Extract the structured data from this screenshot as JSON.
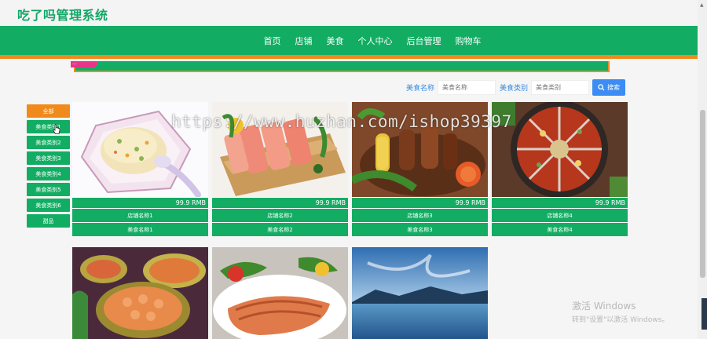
{
  "header": {
    "title": "吃了吗管理系统"
  },
  "nav": {
    "items": [
      "首页",
      "店铺",
      "美食",
      "个人中心",
      "后台管理",
      "购物车"
    ]
  },
  "banner": {
    "tag": "..."
  },
  "search": {
    "food_name_label": "美食名称",
    "food_name_placeholder": "美食名称",
    "food_type_label": "美食类别",
    "food_type_placeholder": "美食类别",
    "button_label": "搜索"
  },
  "sidebar": {
    "items": [
      "全部",
      "美食类别1",
      "美食类别2",
      "美食类别3",
      "美食类别4",
      "美食类别5",
      "美食类别6",
      "甜品"
    ]
  },
  "products": [
    {
      "price": "99.9 RMB",
      "shop": "店铺名称1",
      "food": "美食名称1",
      "image": "fried-rice-plate"
    },
    {
      "price": "99.9 RMB",
      "shop": "店铺名称2",
      "food": "美食名称2",
      "image": "sashimi-board"
    },
    {
      "price": "99.9 RMB",
      "shop": "店铺名称3",
      "food": "美食名称3",
      "image": "bbq-skewers"
    },
    {
      "price": "99.9 RMB",
      "shop": "店铺名称4",
      "food": "美食名称4",
      "image": "hotpot"
    },
    {
      "image": "seafood-platter"
    },
    {
      "image": "grilled-salmon"
    },
    {
      "image": "lake-landscape"
    }
  ],
  "watermark": "https://www.huzhan.com/ishop39397",
  "os_notice": {
    "title": "激活 Windows",
    "subtitle": "转到\"设置\"以激活 Windows。"
  },
  "colors": {
    "brand_green": "#12ad63",
    "accent_orange": "#f18a1c",
    "search_blue": "#3b8df3"
  }
}
